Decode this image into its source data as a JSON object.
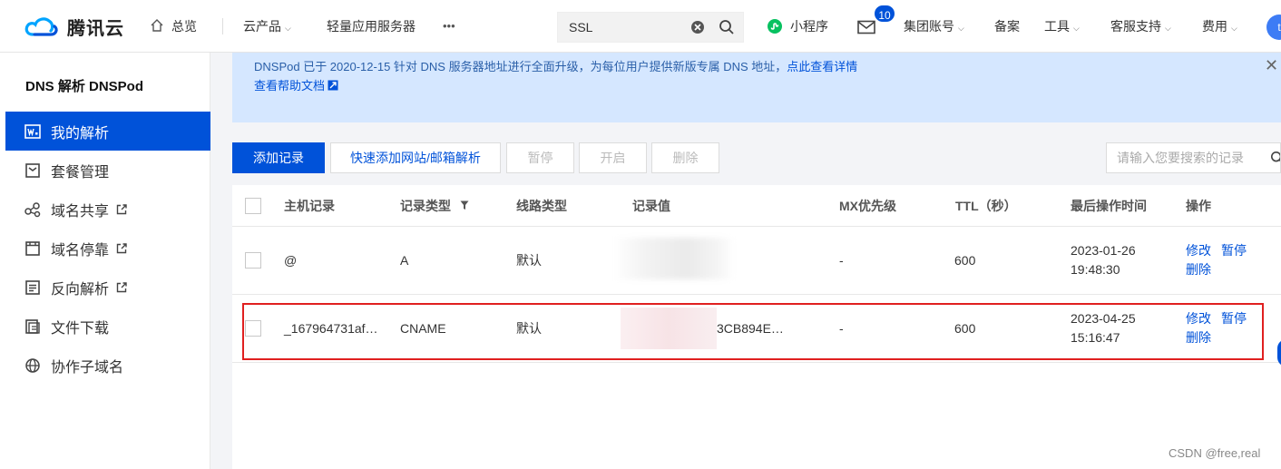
{
  "topnav": {
    "brand": "腾讯云",
    "overview": "总览",
    "products": "云产品",
    "lighthouse": "轻量应用服务器",
    "more": "•••",
    "search_value": "SSL",
    "miniprogram": "小程序",
    "message_count": "10",
    "group_account": "集团账号",
    "icp": "备案",
    "tools": "工具",
    "support": "客服支持",
    "billing": "费用",
    "avatar_text": "t"
  },
  "sidebar": {
    "title": "DNS 解析 DNSPod",
    "items": [
      {
        "label": "我的解析",
        "icon": "dns-record-icon",
        "active": true
      },
      {
        "label": "套餐管理",
        "icon": "package-icon"
      },
      {
        "label": "域名共享",
        "icon": "share-icon",
        "external": true
      },
      {
        "label": "域名停靠",
        "icon": "parking-icon",
        "external": true
      },
      {
        "label": "反向解析",
        "icon": "reverse-dns-icon",
        "external": true
      },
      {
        "label": "文件下载",
        "icon": "file-download-icon"
      },
      {
        "label": "协作子域名",
        "icon": "globe-icon"
      }
    ]
  },
  "notice": {
    "text": "DNSPod 已于 2020-12-15 针对 DNS 服务器地址进行全面升级，为每位用户提供新版专属 DNS 地址，",
    "details_link": "点此查看详情",
    "help_link": "查看帮助文档"
  },
  "toolbar": {
    "add_record": "添加记录",
    "quick_add": "快速添加网站/邮箱解析",
    "pause": "暂停",
    "enable": "开启",
    "delete": "删除",
    "search_placeholder": "请输入您要搜索的记录"
  },
  "table": {
    "headers": {
      "host": "主机记录",
      "type": "记录类型",
      "line": "线路类型",
      "value": "记录值",
      "mx": "MX优先级",
      "ttl": "TTL（秒）",
      "time": "最后操作时间",
      "ops": "操作"
    },
    "rows": [
      {
        "host": "@",
        "type": "A",
        "line": "默认",
        "value": "",
        "mx": "-",
        "ttl": "600",
        "date": "2023-01-26",
        "time": "19:48:30",
        "edit": "修改",
        "pause": "暂停",
        "delete": "删除"
      },
      {
        "host": "_167964731af…",
        "type": "CNAME",
        "line": "默认",
        "value": "3CB894E…",
        "mx": "-",
        "ttl": "600",
        "date": "2023-04-25",
        "time": "15:16:47",
        "edit": "修改",
        "pause": "暂停",
        "delete": "删除"
      }
    ]
  },
  "watermark": "CSDN @free,real",
  "colors": {
    "accent": "#0052d9",
    "notice_bg": "#d5e7ff",
    "highlight": "#e02020"
  }
}
